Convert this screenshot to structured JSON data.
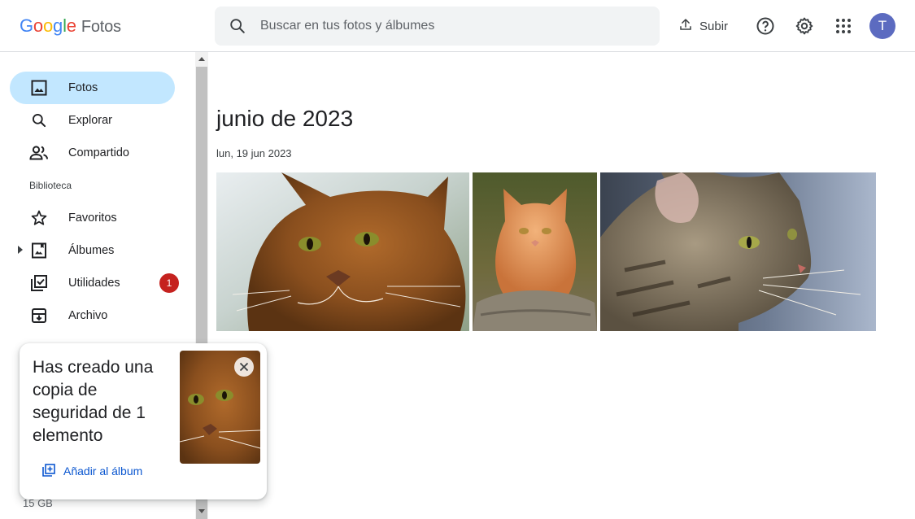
{
  "header": {
    "logo_google": [
      "G",
      "o",
      "o",
      "g",
      "l",
      "e"
    ],
    "logo_colors": [
      "#4285F4",
      "#EA4335",
      "#FBBC05",
      "#4285F4",
      "#34A853",
      "#EA4335"
    ],
    "logo_product": "Fotos",
    "search_placeholder": "Buscar en tus fotos y álbumes",
    "upload_label": "Subir",
    "avatar_initial": "T",
    "icons": [
      "search-icon",
      "upload-icon",
      "help-icon",
      "settings-icon",
      "apps-icon"
    ]
  },
  "sidebar": {
    "items": [
      {
        "label": "Fotos",
        "icon": "photo-icon",
        "active": true
      },
      {
        "label": "Explorar",
        "icon": "search-icon"
      },
      {
        "label": "Compartido",
        "icon": "people-icon"
      },
      {
        "label": "Favoritos",
        "icon": "star-icon"
      },
      {
        "label": "Álbumes",
        "icon": "album-icon"
      },
      {
        "label": "Utilidades",
        "icon": "utilities-icon",
        "badge": "1"
      },
      {
        "label": "Archivo",
        "icon": "archive-icon"
      }
    ],
    "section_label": "Biblioteca",
    "storage_text": "15 GB",
    "badge_color": "#c5221f",
    "active_color": "#c2e7ff"
  },
  "main": {
    "month_title": "junio de 2023",
    "date_label": "lun, 19 jun 2023",
    "photos": [
      "abyssinian-cat-closeup",
      "orange-cat-sitting-on-log",
      "tabby-cat-profile"
    ]
  },
  "toast": {
    "message": "Has creado una copia de seguridad de 1 elemento",
    "action_label": "Añadir al álbum",
    "action_color": "#0b57d0"
  }
}
